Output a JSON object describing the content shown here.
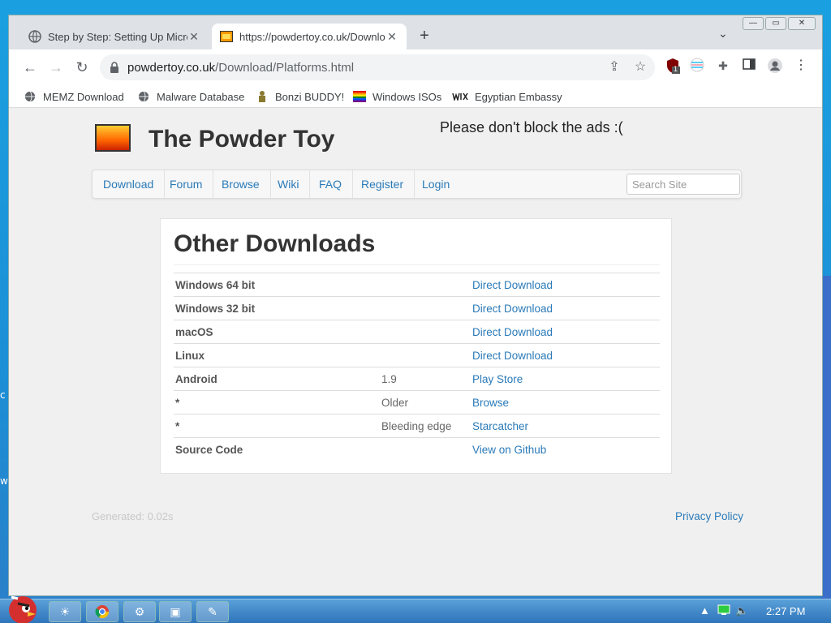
{
  "browser": {
    "tabs": [
      {
        "title": "Step by Step: Setting Up Microsoft",
        "active": false
      },
      {
        "title": "https://powdertoy.co.uk/Download",
        "active": true
      }
    ],
    "new_tab": "+",
    "url_host": "powdertoy.co.uk",
    "url_path": "/Download/Platforms.html",
    "ext_badge": "1",
    "bookmarks": [
      "MEMZ Download",
      "Malware Database",
      "Bonzi BUDDY!",
      "Windows ISOs",
      "Egyptian Embassy"
    ]
  },
  "site": {
    "title": "The Powder Toy",
    "ads_notice": "Please don't block the ads :(",
    "nav": [
      "Download",
      "Forum",
      "Browse",
      "Wiki",
      "FAQ",
      "Register",
      "Login"
    ],
    "search_placeholder": "Search Site"
  },
  "downloads": {
    "heading": "Other Downloads",
    "rows": [
      {
        "name": "Windows 64 bit",
        "version": "",
        "link": "Direct Download"
      },
      {
        "name": "Windows 32 bit",
        "version": "",
        "link": "Direct Download"
      },
      {
        "name": "macOS",
        "version": "",
        "link": "Direct Download"
      },
      {
        "name": "Linux",
        "version": "",
        "link": "Direct Download"
      },
      {
        "name": "Android",
        "version": "1.9",
        "link": "Play Store"
      },
      {
        "name": "*",
        "version": "Older",
        "link": "Browse"
      },
      {
        "name": "*",
        "version": "Bleeding edge",
        "link": "Starcatcher"
      },
      {
        "name": "Source Code",
        "version": "",
        "link": "View on Github"
      }
    ]
  },
  "footer": {
    "generated": "Generated: 0.02s",
    "privacy": "Privacy Policy"
  },
  "taskbar": {
    "clock": "2:27 PM"
  },
  "colors": {
    "link": "#2a7ab8",
    "page_bg": "#f0f0f0"
  }
}
